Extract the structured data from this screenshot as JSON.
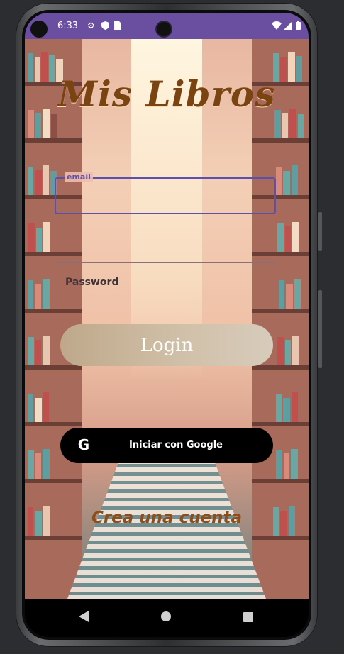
{
  "status_bar": {
    "time": "6:33",
    "icons": [
      "settings-icon",
      "shield-icon",
      "sim-card-icon",
      "wifi-icon",
      "signal-icon",
      "battery-icon"
    ]
  },
  "app": {
    "title": "Mis Libros",
    "email_label": "email",
    "email_value": "",
    "password_placeholder": "Password",
    "login_label": "Login",
    "google_label": "Iniciar con Google",
    "create_account_label": "Crea una cuenta"
  },
  "nav_bar": {
    "buttons": [
      "back-icon",
      "home-icon",
      "recents-icon"
    ]
  },
  "colors": {
    "status_bar": "#6a4fa0",
    "field_outline": "#5b4fb0",
    "title": "#7a4412",
    "create_link": "#8a4f1d"
  }
}
